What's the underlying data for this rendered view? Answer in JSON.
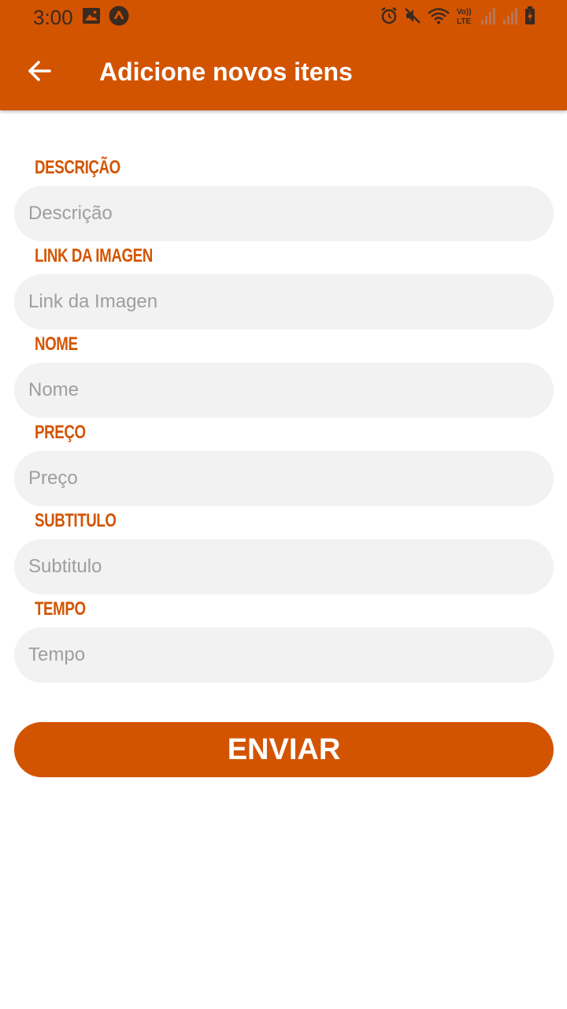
{
  "status_bar": {
    "time": "3:00",
    "left_icons": [
      "image-icon",
      "app-notification-icon"
    ],
    "right_icons": [
      "alarm-icon",
      "mute-icon",
      "wifi-icon",
      "volte-icon",
      "signal-icon",
      "signal-icon",
      "battery-icon"
    ],
    "volte_text": "Vo)) LTE"
  },
  "app_bar": {
    "title": "Adicione novos itens",
    "back_icon": "arrow-left-icon"
  },
  "form": {
    "fields": [
      {
        "label": "Descrição",
        "placeholder": "Descrição",
        "value": ""
      },
      {
        "label": "Link da Imagen",
        "placeholder": "Link da Imagen",
        "value": ""
      },
      {
        "label": "Nome",
        "placeholder": "Nome",
        "value": ""
      },
      {
        "label": "Preço",
        "placeholder": "Preço",
        "value": ""
      },
      {
        "label": "Subtitulo",
        "placeholder": "Subtitulo",
        "value": ""
      },
      {
        "label": "Tempo",
        "placeholder": "Tempo",
        "value": ""
      }
    ],
    "submit_label": "ENVIAR"
  },
  "colors": {
    "primary": "#d35400",
    "input_background": "#f2f2f2",
    "placeholder": "#9e9e9e",
    "status_icons": "#3a2a20"
  }
}
